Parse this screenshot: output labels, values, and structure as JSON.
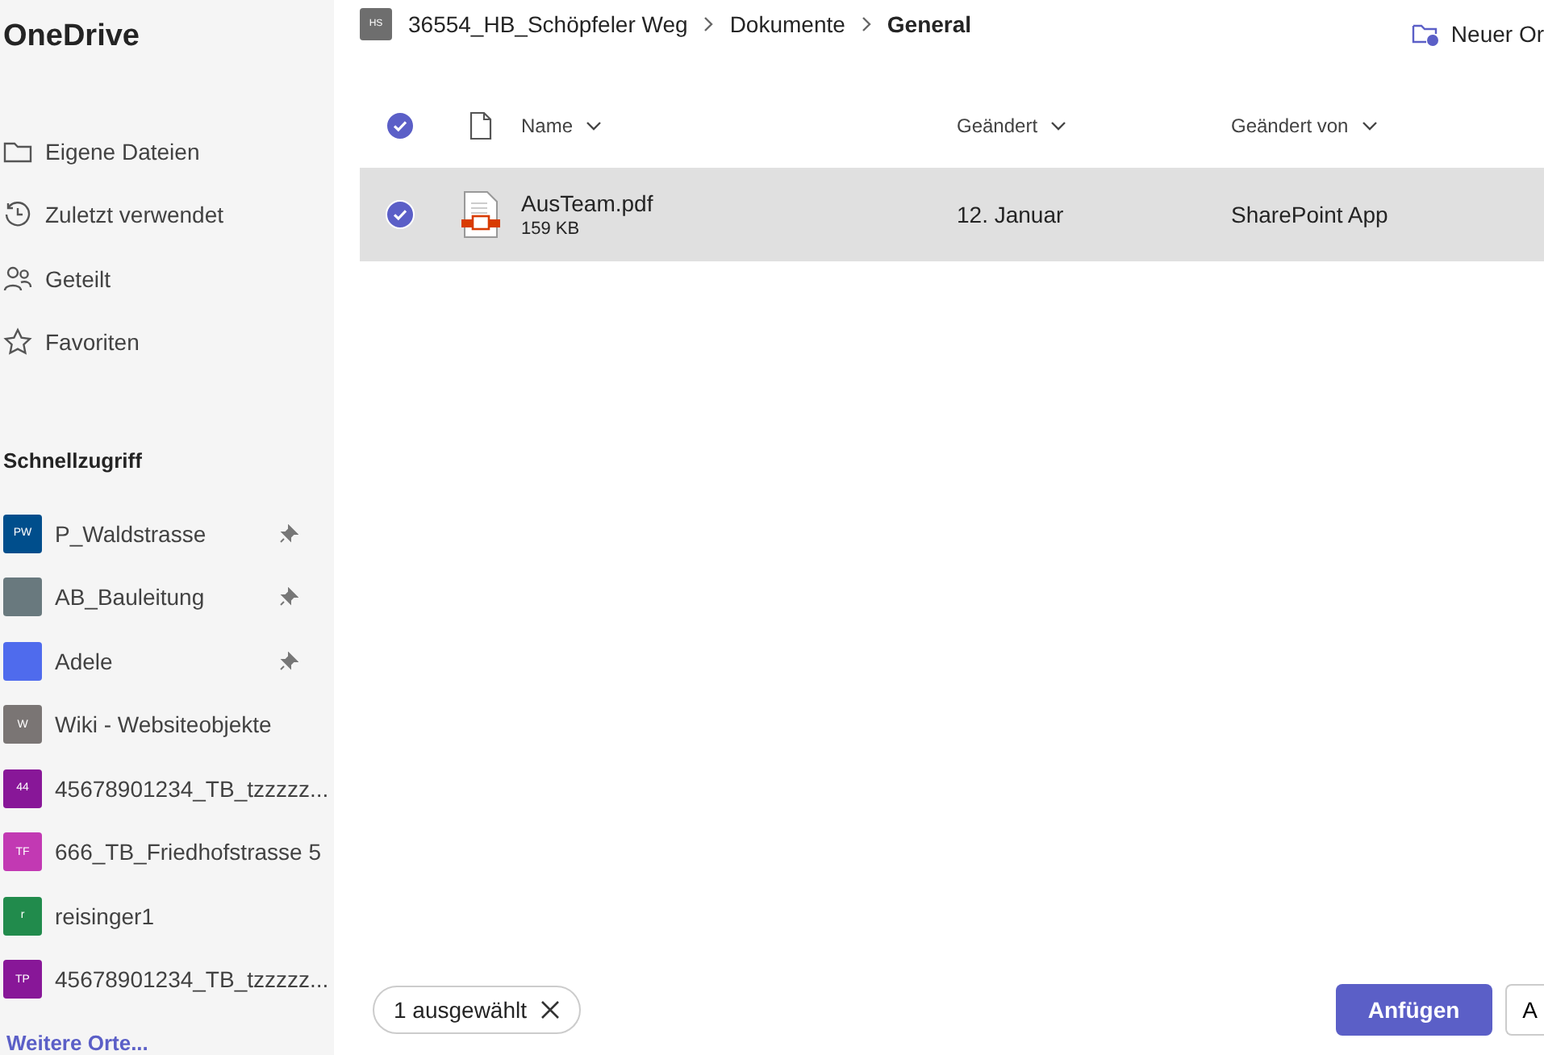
{
  "app_title": "OneDrive",
  "nav": [
    {
      "kind": "folder",
      "label": "Eigene Dateien"
    },
    {
      "kind": "recent",
      "label": "Zuletzt verwendet"
    },
    {
      "kind": "shared",
      "label": "Geteilt"
    },
    {
      "kind": "star",
      "label": "Favoriten"
    }
  ],
  "quick_access": {
    "title": "Schnellzugriff",
    "items": [
      {
        "initials": "PW",
        "color": "#004e8c",
        "label": "P_Waldstrasse",
        "pinned": true
      },
      {
        "color": "#69797e",
        "label": "AB_Bauleitung",
        "pinned": true
      },
      {
        "color": "#4f6bed",
        "label": "Adele",
        "pinned": true
      },
      {
        "initials": "W",
        "color": "#7a7574",
        "label": "Wiki - Websiteobjekte",
        "pinned": false
      },
      {
        "initials": "44",
        "color": "#881798",
        "label": "45678901234_TB_tzzzzz...",
        "pinned": false
      },
      {
        "initials": "TF",
        "color": "#c239b3",
        "label": "666_TB_Friedhofstrasse 5",
        "pinned": false
      },
      {
        "initials": "r",
        "color": "#218b4c",
        "label": "reisinger1",
        "pinned": false
      },
      {
        "initials": "TP",
        "color": "#881798",
        "label": "45678901234_TB_tzzzzz...",
        "pinned": false
      }
    ],
    "more_link": "Weitere Orte..."
  },
  "breadcrumb": {
    "site_initials": "HS",
    "items": [
      "36554_HB_Schöpfeler Weg",
      "Dokumente",
      "General"
    ]
  },
  "new_folder": "Neuer Or",
  "table": {
    "all_selected": true,
    "columns": [
      "Name",
      "Geändert",
      "Geändert von"
    ],
    "rows": [
      {
        "selected": true,
        "name": "AusTeam.pdf",
        "size": "159 KB",
        "modified": "12. Januar",
        "modified_by": "SharePoint App"
      }
    ]
  },
  "footer": {
    "selection": "1 ausgewählt",
    "primary_button": "Anfügen",
    "secondary_button": "A"
  }
}
